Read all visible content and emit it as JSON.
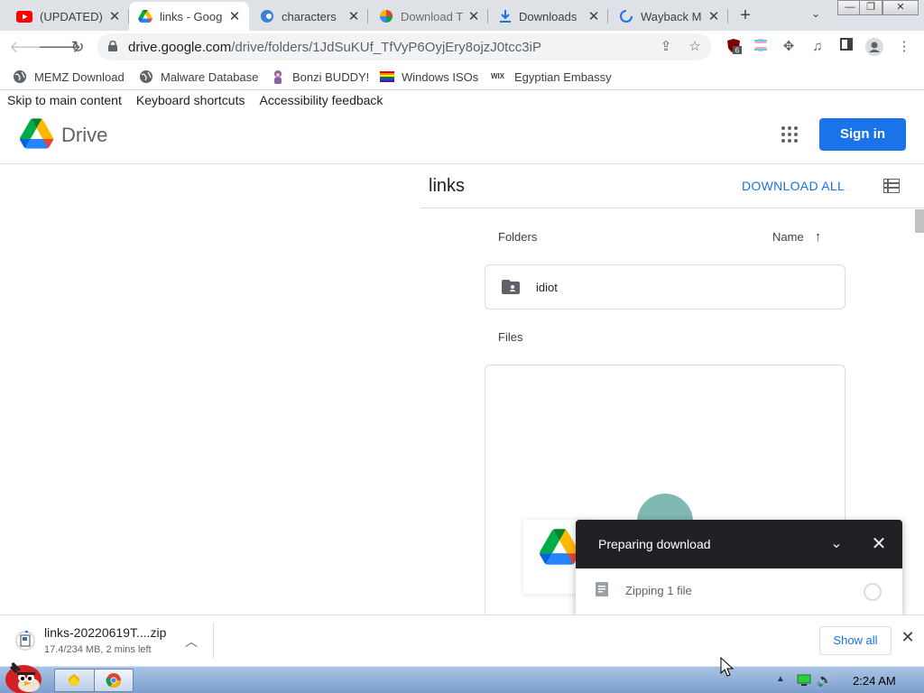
{
  "browser": {
    "tabs": [
      {
        "title": "(UPDATED)",
        "icon": "youtube-icon",
        "active": false
      },
      {
        "title": "links - Goog",
        "icon": "google-drive-icon",
        "active": true
      },
      {
        "title": "characters",
        "icon": "site-favicon-icon",
        "active": false
      },
      {
        "title": "Download T",
        "icon": "site-favicon-icon",
        "active": false
      },
      {
        "title": "Downloads",
        "icon": "download-icon",
        "active": false
      },
      {
        "title": "Wayback M",
        "icon": "loading-spinner-icon",
        "active": false
      }
    ],
    "new_tab_symbol": "+",
    "url_host": "drive.google.com",
    "url_path": "/drive/folders/1JdSuKUf_TfVyP6OyjEry8ojzJ0tcc3iP",
    "extension_badge": "6",
    "bookmarks": [
      {
        "label": "MEMZ Download",
        "icon": "globe-icon"
      },
      {
        "label": "Malware Database",
        "icon": "globe-icon"
      },
      {
        "label": "Bonzi BUDDY!",
        "icon": "bonzi-icon"
      },
      {
        "label": "Windows ISOs",
        "icon": "rainbow-flag-icon"
      },
      {
        "label": "Egyptian Embassy",
        "icon": "wix-icon",
        "icon_text": "WIX"
      }
    ]
  },
  "page": {
    "skip_links": [
      "Skip to main content",
      "Keyboard shortcuts",
      "Accessibility feedback"
    ],
    "app_name": "Drive",
    "sign_in_label": "Sign in",
    "folder_title": "links",
    "download_all_label": "DOWNLOAD ALL",
    "folders_label": "Folders",
    "sort_label": "Name",
    "folders": [
      {
        "name": "idiot"
      }
    ],
    "files_label": "Files"
  },
  "download_panel": {
    "title": "Preparing download",
    "status": "Zipping 1 file"
  },
  "download_shelf": {
    "file_name": "links-20220619T....zip",
    "status": "17.4/234 MB, 2 mins left",
    "show_all_label": "Show all"
  },
  "taskbar": {
    "clock": "2:24 AM"
  },
  "colors": {
    "accent": "#1a73e8",
    "panel_header": "#202124",
    "taskbar": "#7d9fcd"
  }
}
